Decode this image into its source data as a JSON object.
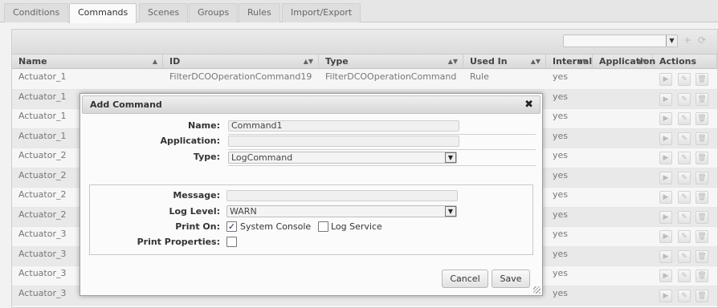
{
  "tabs": [
    {
      "label": "Conditions",
      "active": false
    },
    {
      "label": "Commands",
      "active": true
    },
    {
      "label": "Scenes",
      "active": false
    },
    {
      "label": "Groups",
      "active": false
    },
    {
      "label": "Rules",
      "active": false
    },
    {
      "label": "Import/Export",
      "active": false
    }
  ],
  "toolbar": {
    "select_value": "",
    "add_icon": "plus-icon",
    "refresh_icon": "refresh-icon"
  },
  "table": {
    "columns": [
      "Name",
      "ID",
      "Type",
      "Used In",
      "Internal",
      "Application",
      "Actions"
    ],
    "rows": [
      {
        "name": "Actuator_1",
        "id": "FilterDCOOperationCommand19",
        "type": "FilterDCOOperationCommand",
        "used_in": "Rule",
        "internal": "yes"
      },
      {
        "name": "Actuator_1",
        "id": "",
        "type": "",
        "used_in": "",
        "internal": "yes"
      },
      {
        "name": "Actuator_1",
        "id": "",
        "type": "",
        "used_in": "",
        "internal": "yes"
      },
      {
        "name": "Actuator_1",
        "id": "",
        "type": "",
        "used_in": "",
        "internal": "yes"
      },
      {
        "name": "Actuator_2",
        "id": "",
        "type": "",
        "used_in": "",
        "internal": "yes"
      },
      {
        "name": "Actuator_2",
        "id": "",
        "type": "",
        "used_in": "",
        "internal": "yes"
      },
      {
        "name": "Actuator_2",
        "id": "",
        "type": "",
        "used_in": "",
        "internal": "yes"
      },
      {
        "name": "Actuator_2",
        "id": "",
        "type": "",
        "used_in": "",
        "internal": "yes"
      },
      {
        "name": "Actuator_3",
        "id": "",
        "type": "",
        "used_in": "",
        "internal": "yes"
      },
      {
        "name": "Actuator_3",
        "id": "",
        "type": "",
        "used_in": "",
        "internal": "yes"
      },
      {
        "name": "Actuator_3",
        "id": "",
        "type": "",
        "used_in": "",
        "internal": "yes"
      },
      {
        "name": "Actuator_3",
        "id": "",
        "type": "",
        "used_in": "",
        "internal": "yes"
      }
    ]
  },
  "dialog": {
    "title": "Add Command",
    "name_label": "Name:",
    "name_value": "Command1",
    "application_label": "Application:",
    "application_value": "",
    "type_label": "Type:",
    "type_value": "LogCommand",
    "message_label": "Message:",
    "message_value": "",
    "log_level_label": "Log Level:",
    "log_level_value": "WARN",
    "print_on_label": "Print On:",
    "system_console_label": "System Console",
    "system_console_checked": true,
    "log_service_label": "Log Service",
    "log_service_checked": false,
    "print_properties_label": "Print Properties:",
    "print_properties_checked": false,
    "cancel_label": "Cancel",
    "save_label": "Save"
  }
}
